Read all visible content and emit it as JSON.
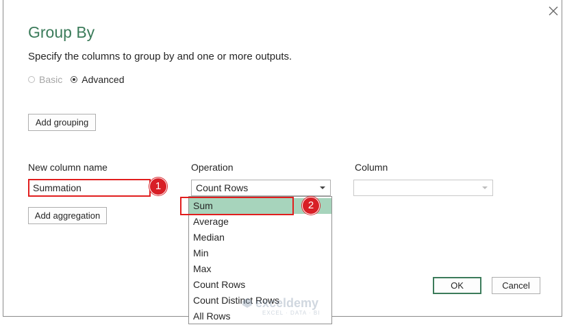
{
  "dialog": {
    "title": "Group By",
    "subtitle": "Specify the columns to group by and one or more outputs.",
    "mode": {
      "basic_label": "Basic",
      "advanced_label": "Advanced",
      "selected": "Advanced"
    },
    "add_grouping_label": "Add grouping",
    "add_aggregation_label": "Add aggregation",
    "ok_label": "OK",
    "cancel_label": "Cancel",
    "close_icon": "close-icon"
  },
  "aggregation": {
    "new_column_name_label": "New column name",
    "operation_label": "Operation",
    "column_label": "Column",
    "new_column_name_value": "Summation",
    "operation_value": "Count Rows",
    "column_value": ""
  },
  "operation_dropdown": {
    "items": [
      "Sum",
      "Average",
      "Median",
      "Min",
      "Max",
      "Count Rows",
      "Count Distinct Rows",
      "All Rows"
    ],
    "highlighted": "Sum"
  },
  "annotations": {
    "badge_1": "1",
    "badge_2": "2"
  },
  "watermark": {
    "name": "exceldemy",
    "tagline": "EXCEL · DATA · BI"
  },
  "colors": {
    "title_green": "#3b7b5a",
    "highlight": "#a7d4bc",
    "callout_red": "#e11d1d",
    "badge_red": "#d81f26"
  }
}
